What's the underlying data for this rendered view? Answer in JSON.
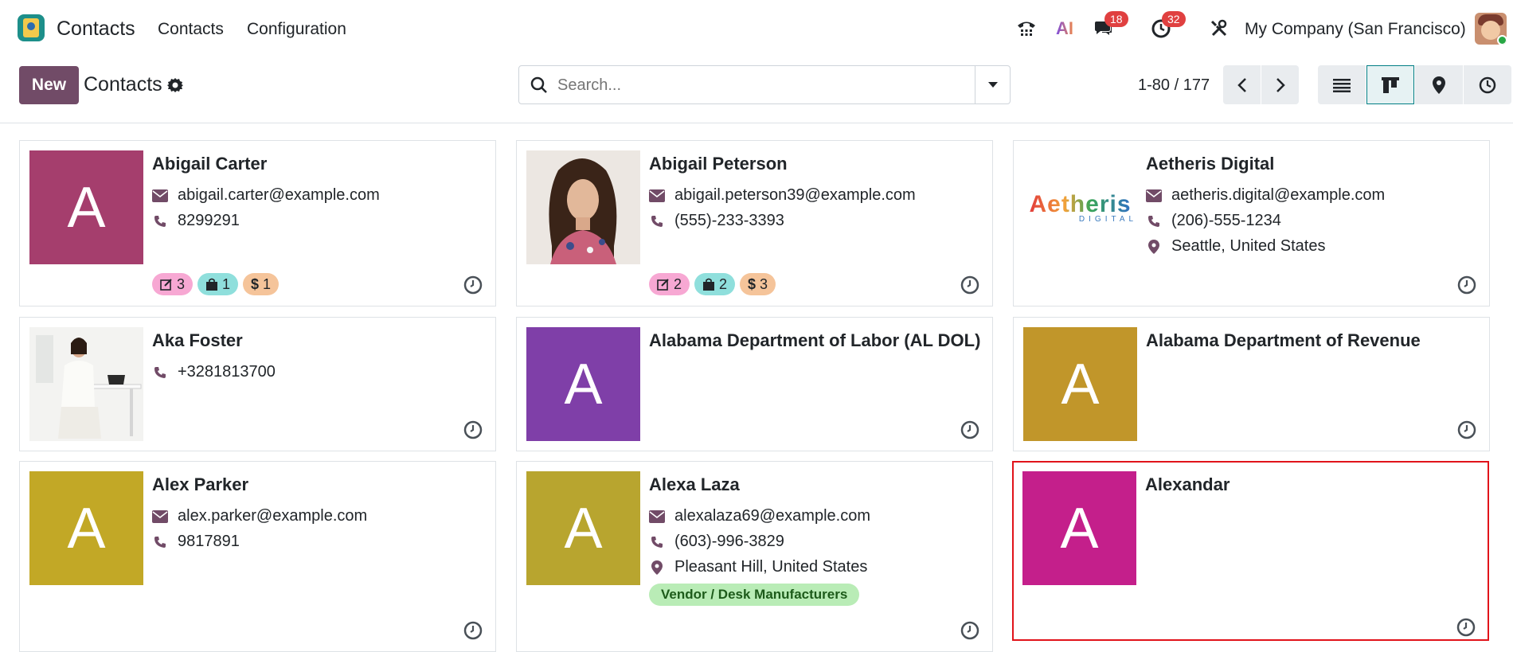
{
  "app": {
    "name": "Contacts"
  },
  "nav": {
    "menu": [
      "Contacts",
      "Configuration"
    ]
  },
  "systray": {
    "messages_count": "18",
    "activities_count": "32",
    "company": "My Company (San Francisco)",
    "ai_label": "AI"
  },
  "control": {
    "new_label": "New",
    "title": "Contacts",
    "search_placeholder": "Search...",
    "pager": "1-80 / 177",
    "active_view": "kanban"
  },
  "colors": {
    "brand": "#714b67",
    "accent": "#017e84",
    "badge": "#e04040",
    "selected_border": "#e1131a"
  },
  "cards": [
    {
      "name": "Abigail Carter",
      "avatar_letter": "A",
      "avatar_color": "#a53e6d",
      "email": "abigail.carter@example.com",
      "phone": "8299291",
      "stats": {
        "quotations": "3",
        "orders": "1",
        "invoices": "1"
      }
    },
    {
      "name": "Abigail Peterson",
      "avatar_type": "photo",
      "email": "abigail.peterson39@example.com",
      "phone": "(555)-233-3393",
      "stats": {
        "quotations": "2",
        "orders": "2",
        "invoices": "3"
      }
    },
    {
      "name": "Aetheris Digital",
      "avatar_type": "logo",
      "logo_text": "Aetheris",
      "logo_sub": "DIGITAL",
      "email": "aetheris.digital@example.com",
      "phone": "(206)-555-1234",
      "location": "Seattle, United States"
    },
    {
      "name": "Aka Foster",
      "avatar_type": "photo",
      "phone": "+3281813700"
    },
    {
      "name": "Alabama Department of Labor (AL DOL)",
      "avatar_letter": "A",
      "avatar_color": "#7f3fa8"
    },
    {
      "name": "Alabama Department of Revenue",
      "avatar_letter": "A",
      "avatar_color": "#c1962a"
    },
    {
      "name": "Alex Parker",
      "avatar_letter": "A",
      "avatar_color": "#c2a826",
      "email": "alex.parker@example.com",
      "phone": "9817891"
    },
    {
      "name": "Alexa Laza",
      "avatar_letter": "A",
      "avatar_color": "#b8a52f",
      "email": "alexalaza69@example.com",
      "phone": "(603)-996-3829",
      "location": "Pleasant Hill, United States",
      "tag": "Vendor / Desk Manufacturers"
    },
    {
      "name": "Alexandar",
      "avatar_letter": "A",
      "avatar_color": "#c41f8b",
      "selected": true
    }
  ]
}
